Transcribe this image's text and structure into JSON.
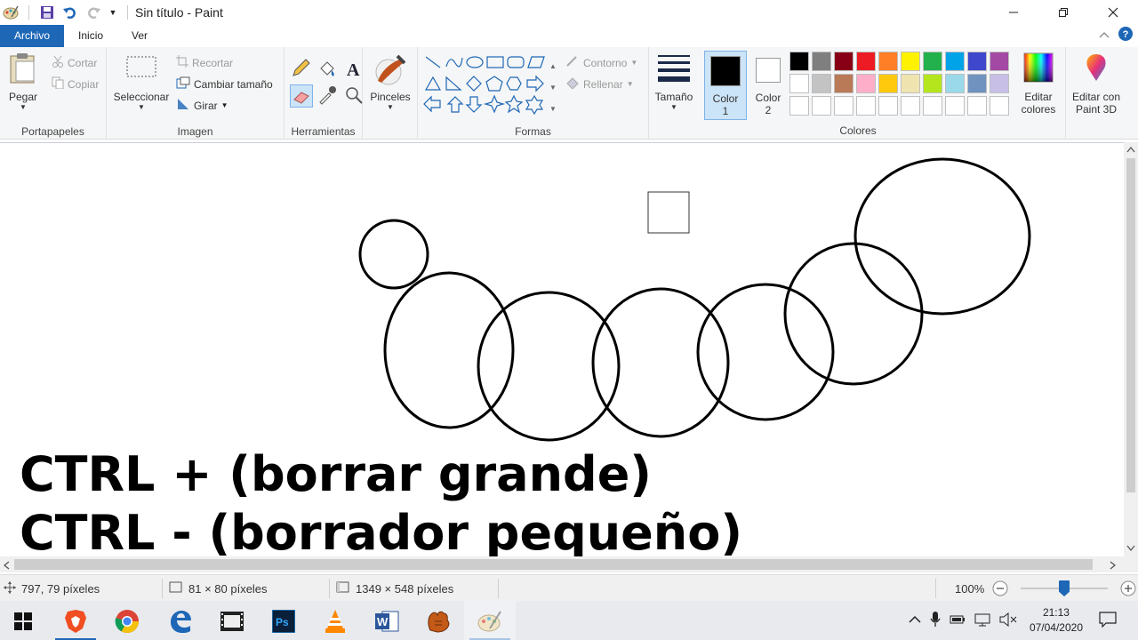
{
  "window": {
    "title": "Sin título - Paint"
  },
  "tabs": [
    {
      "label": "Archivo",
      "active": true
    },
    {
      "label": "Inicio",
      "active": false
    },
    {
      "label": "Ver",
      "active": false
    }
  ],
  "ribbon": {
    "clipboard": {
      "label": "Portapapeles",
      "paste": "Pegar",
      "cut": "Cortar",
      "copy": "Copiar"
    },
    "image": {
      "label": "Imagen",
      "select": "Seleccionar",
      "crop": "Recortar",
      "resize": "Cambiar tamaño",
      "rotate": "Girar"
    },
    "tools": {
      "label": "Herramientas"
    },
    "brushes": {
      "label": "Pinceles"
    },
    "shapes": {
      "label": "Formas",
      "outline": "Contorno",
      "fill": "Rellenar"
    },
    "size": {
      "label": "Tamaño"
    },
    "color1": {
      "label": "Color",
      "num": "1"
    },
    "color2": {
      "label": "Color",
      "num": "2"
    },
    "colors": {
      "label": "Colores",
      "edit_label": "Editar",
      "edit_label2": "colores"
    },
    "paint3d": {
      "label": "Editar con",
      "label2": "Paint 3D"
    },
    "palette": [
      "#000000",
      "#7f7f7f",
      "#880015",
      "#ed1c24",
      "#ff7f27",
      "#fff200",
      "#22b14c",
      "#00a2e8",
      "#3f48cc",
      "#a349a4",
      "#ffffff",
      "#c3c3c3",
      "#b97a57",
      "#ffaec9",
      "#ffc90e",
      "#efe4b0",
      "#b5e61d",
      "#99d9ea",
      "#7092be",
      "#c8bfe7",
      "#ffffff",
      "#ffffff",
      "#ffffff",
      "#ffffff",
      "#ffffff",
      "#ffffff",
      "#ffffff",
      "#ffffff",
      "#ffffff",
      "#ffffff"
    ],
    "color1_value": "#000000",
    "color2_value": "#ffffff"
  },
  "canvas": {
    "line1": "CTRL + (borrar grande)",
    "line2": "CTRL - (borrador pequeño)"
  },
  "status": {
    "cursor": "797, 79 píxeles",
    "selection": "81 × 80 píxeles",
    "canvas_size": "1349 × 548 píxeles",
    "zoom": "100%",
    "zoom_level": 0.5
  },
  "taskbar": {
    "time": "21:13",
    "date": "07/04/2020"
  }
}
